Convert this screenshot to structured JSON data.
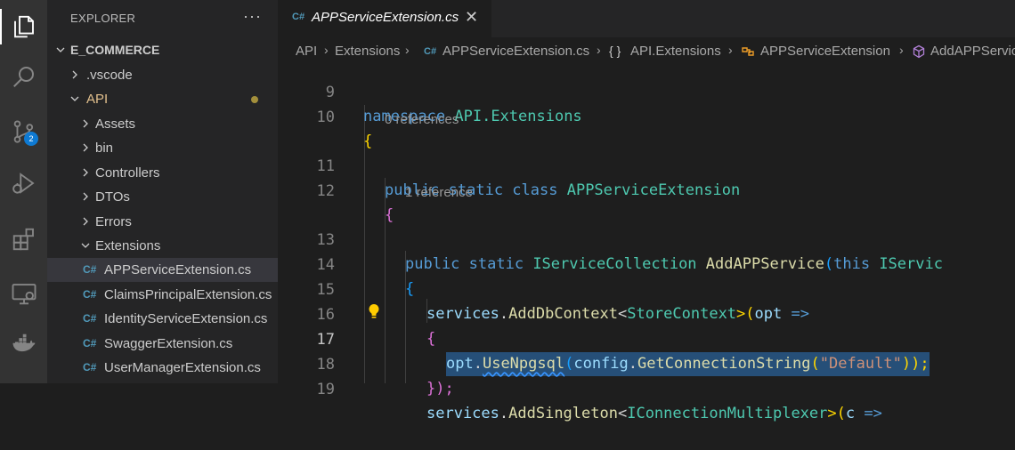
{
  "activity_bar": {
    "items": [
      "explorer-icon",
      "search-icon",
      "source-control-icon",
      "run-debug-icon",
      "extensions-icon",
      "remote-explorer-icon",
      "docker-icon"
    ],
    "source_control_badge": "2"
  },
  "explorer": {
    "title": "EXPLORER",
    "more": "···",
    "root": "E_COMMERCE",
    "tree": [
      {
        "label": ".vscode",
        "type": "folder",
        "expanded": false
      },
      {
        "label": "API",
        "type": "folder",
        "expanded": true,
        "modified": true
      },
      {
        "label": "Assets",
        "type": "folder",
        "expanded": false
      },
      {
        "label": "bin",
        "type": "folder",
        "expanded": false
      },
      {
        "label": "Controllers",
        "type": "folder",
        "expanded": false
      },
      {
        "label": "DTOs",
        "type": "folder",
        "expanded": false
      },
      {
        "label": "Errors",
        "type": "folder",
        "expanded": false
      },
      {
        "label": "Extensions",
        "type": "folder",
        "expanded": true
      },
      {
        "label": "APPServiceExtension.cs",
        "type": "file",
        "selected": true
      },
      {
        "label": "ClaimsPrincipalExtension.cs",
        "type": "file"
      },
      {
        "label": "IdentityServiceExtension.cs",
        "type": "file"
      },
      {
        "label": "SwaggerExtension.cs",
        "type": "file"
      },
      {
        "label": "UserManagerExtension.cs",
        "type": "file"
      }
    ],
    "file_icon_text": "C#"
  },
  "editor": {
    "tab": {
      "label": "APPServiceExtension.cs",
      "close": "✕"
    },
    "breadcrumb": [
      "API",
      "Extensions",
      "APPServiceExtension.cs",
      "API.Extensions",
      "APPServiceExtension",
      "AddAPPService"
    ],
    "breadcrumb_sep": "›",
    "codelens": [
      "0 references",
      "1 reference"
    ],
    "line_numbers": [
      "9",
      "10",
      "11",
      "12",
      "13",
      "14",
      "15",
      "16",
      "17",
      "18",
      "19"
    ],
    "code": {
      "l9_kw": "namespace",
      "l9_ns": "API.Extensions",
      "l10": "{",
      "l11_kw": "public static class",
      "l11_type": "APPServiceExtension",
      "l12": "{",
      "l13_kw": "public static",
      "l13_type": "IServiceCollection",
      "l13_fn": "AddAPPService",
      "l13_paren": "(",
      "l13_this": "this",
      "l13_param_type": "IServic",
      "l14": "{",
      "l15_id": "services",
      "l15_fn": "AddDbContext",
      "l15_lt": "<",
      "l15_type": "StoreContext",
      "l15_rest": ">(",
      "l15_param": "opt",
      "l15_arrow": " =>",
      "l16": "{",
      "l17_id": "opt",
      "l17_fn": "UseNpgsql",
      "l17_paren": "(",
      "l17_id2": "config",
      "l17_fn2": "GetConnectionString",
      "l17_paren2": "(",
      "l17_str": "\"Default\"",
      "l17_close": "));",
      "l18": "});",
      "l19_id": "services",
      "l19_fn": "AddSingleton",
      "l19_lt": "<",
      "l19_type": "IConnectionMultiplexer",
      "l19_rest": ">(",
      "l19_param": "c",
      "l19_arrow": " =>"
    }
  }
}
